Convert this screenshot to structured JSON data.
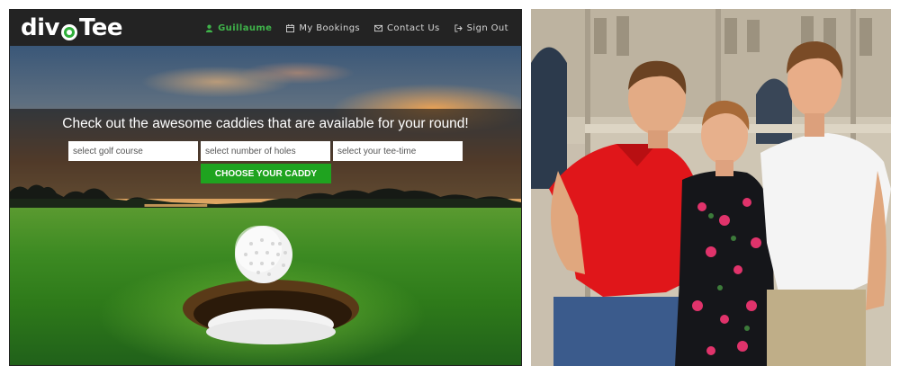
{
  "site": {
    "logo": {
      "text_before": "div",
      "text_after": "Tee"
    },
    "nav": {
      "items": [
        {
          "label": "Guillaume",
          "icon": "user-icon",
          "active": true
        },
        {
          "label": "My Bookings",
          "icon": "calendar-icon",
          "active": false
        },
        {
          "label": "Contact Us",
          "icon": "envelope-icon",
          "active": false
        },
        {
          "label": "Sign Out",
          "icon": "sign-out-icon",
          "active": false
        }
      ]
    },
    "hero": {
      "headline": "Check out the awesome caddies that are available for your round!",
      "search": {
        "course_placeholder": "select golf course",
        "holes_placeholder": "select number of holes",
        "teetime_placeholder": "select your tee-time"
      },
      "cta_label": "CHOOSE YOUR CADDY"
    },
    "colors": {
      "brand_green": "#1fa31f",
      "nav_active": "#3fb34a",
      "navbar_bg": "#232323"
    }
  },
  "photo": {
    "subject": "three-people-photo"
  }
}
